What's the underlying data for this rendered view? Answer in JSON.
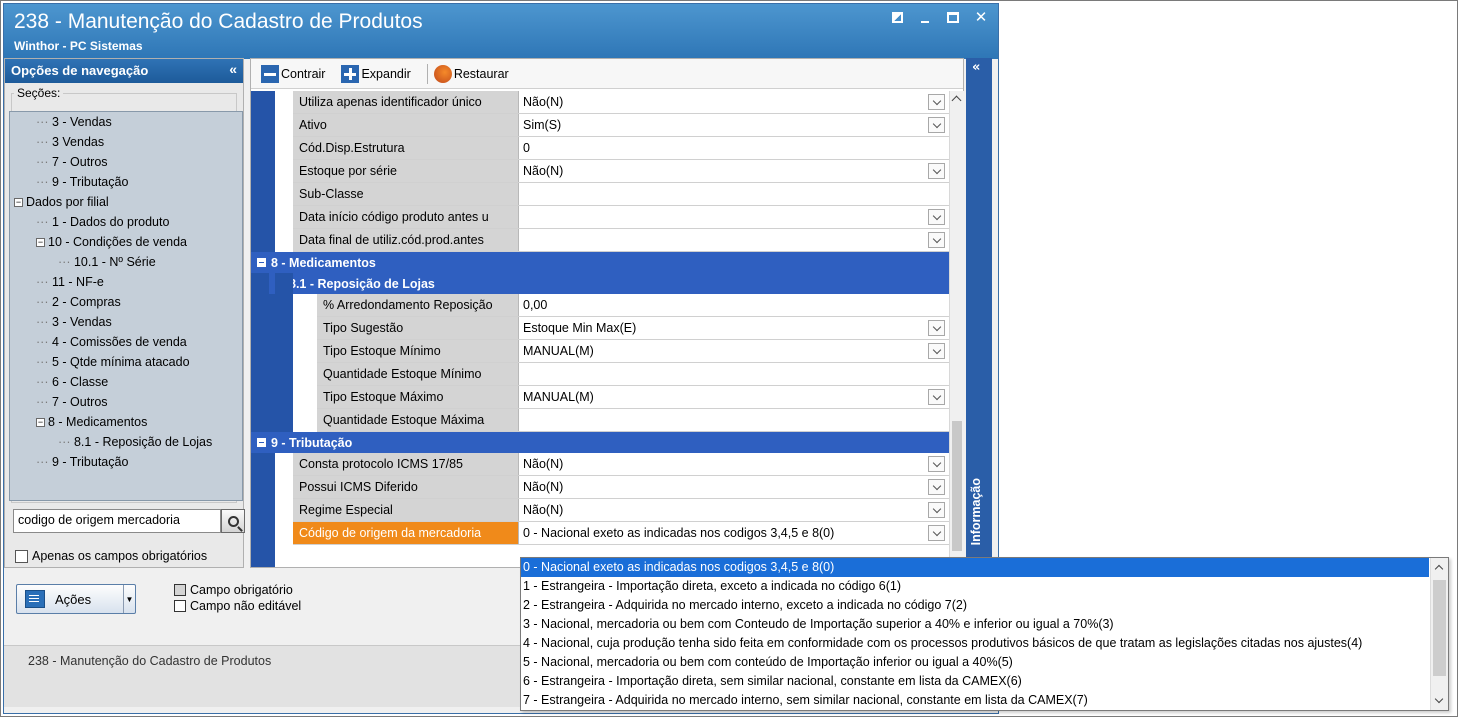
{
  "window": {
    "title": "238 - Manutenção do Cadastro de Produtos",
    "subtitle": "Winthor - PC Sistemas"
  },
  "nav": {
    "header": "Opções de navegação",
    "sections_label": "Seções:",
    "tree": [
      {
        "label": "3 - Vendas",
        "level": 1,
        "type": "leaf"
      },
      {
        "label": "3 Vendas",
        "level": 1,
        "type": "leaf"
      },
      {
        "label": "7 - Outros",
        "level": 1,
        "type": "leaf"
      },
      {
        "label": "9 - Tributação",
        "level": 1,
        "type": "leaf"
      },
      {
        "label": "Dados por filial",
        "level": 0,
        "type": "expanded"
      },
      {
        "label": "1 - Dados do produto",
        "level": 1,
        "type": "leaf"
      },
      {
        "label": "10 - Condições de venda",
        "level": 1,
        "type": "expanded"
      },
      {
        "label": "10.1 - Nº Série",
        "level": 2,
        "type": "leaf"
      },
      {
        "label": "11 - NF-e",
        "level": 1,
        "type": "leaf"
      },
      {
        "label": "2 - Compras",
        "level": 1,
        "type": "leaf"
      },
      {
        "label": "3 - Vendas",
        "level": 1,
        "type": "leaf"
      },
      {
        "label": "4 - Comissões de venda",
        "level": 1,
        "type": "leaf"
      },
      {
        "label": "5 - Qtde mínima atacado",
        "level": 1,
        "type": "leaf"
      },
      {
        "label": "6 - Classe",
        "level": 1,
        "type": "leaf"
      },
      {
        "label": "7 - Outros",
        "level": 1,
        "type": "leaf"
      },
      {
        "label": "8 - Medicamentos",
        "level": 1,
        "type": "expanded"
      },
      {
        "label": "8.1 -  Reposição de Lojas",
        "level": 2,
        "type": "leaf"
      },
      {
        "label": "9 - Tributação",
        "level": 1,
        "type": "leaf"
      }
    ],
    "search_value": "codigo de origem mercadoria",
    "required_only_label": "Apenas os campos obrigatórios"
  },
  "actions": {
    "button_label": "Ações",
    "legend_required": "Campo obrigatório",
    "legend_not_editable": "Campo não editável"
  },
  "status_bar": {
    "text": "238 - Manutenção do Cadastro de Produtos"
  },
  "toolbar": {
    "collapse_label": "Contrair",
    "expand_label": "Expandir",
    "restore_label": "Restaurar"
  },
  "grid": {
    "rows_top": [
      {
        "label": "Utiliza apenas identificador único",
        "value": "Não(N)",
        "dropdown": true
      },
      {
        "label": "Ativo",
        "value": "Sim(S)",
        "dropdown": true
      },
      {
        "label": "Cód.Disp.Estrutura",
        "value": "0",
        "dropdown": false
      },
      {
        "label": "Estoque por série",
        "value": "Não(N)",
        "dropdown": true
      },
      {
        "label": "Sub-Classe",
        "value": "",
        "dropdown": false
      },
      {
        "label": "Data início código produto antes u",
        "value": "",
        "dropdown": true
      },
      {
        "label": "Data final de utiliz.cód.prod.antes",
        "value": "",
        "dropdown": true
      }
    ],
    "section_8": "8 - Medicamentos",
    "section_81": "8.1 -  Reposição de Lojas",
    "rows_81": [
      {
        "label": "% Arredondamento Reposição",
        "value": "0,00",
        "dropdown": false
      },
      {
        "label": "Tipo Sugestão",
        "value": "Estoque Min Max(E)",
        "dropdown": true
      },
      {
        "label": "Tipo Estoque Mínimo",
        "value": "MANUAL(M)",
        "dropdown": true
      },
      {
        "label": "Quantidade Estoque Mínimo",
        "value": "",
        "dropdown": false
      },
      {
        "label": "Tipo Estoque Máximo",
        "value": "MANUAL(M)",
        "dropdown": true
      },
      {
        "label": "Quantidade Estoque Máxima",
        "value": "",
        "dropdown": false
      }
    ],
    "section_9": "9 - Tributação",
    "rows_9": [
      {
        "label": "Consta protocolo ICMS 17/85",
        "value": "Não(N)",
        "dropdown": true
      },
      {
        "label": "Possui ICMS Diferido",
        "value": "Não(N)",
        "dropdown": true
      },
      {
        "label": "Regime Especial",
        "value": "Não(N)",
        "dropdown": true
      },
      {
        "label": "Código de origem da mercadoria",
        "value": "0 - Nacional exeto as indicadas nos codigos 3,4,5 e 8(0)",
        "dropdown": true
      }
    ]
  },
  "info_panel": {
    "label": "Informação"
  },
  "origin_dropdown": {
    "options": [
      "0 - Nacional exeto as indicadas nos codigos 3,4,5 e 8(0)",
      "1 - Estrangeira - Importação direta, exceto a indicada no código 6(1)",
      "2 - Estrangeira - Adquirida no mercado interno, exceto a indicada no código 7(2)",
      "3 - Nacional, mercadoria ou bem com Conteudo de Importação superior a 40% e inferior ou igual a 70%(3)",
      "4 - Nacional, cuja produção tenha sido feita em conformidade com os processos produtivos básicos de que tratam as legislações citadas nos ajustes(4)",
      "5 - Nacional, mercadoria ou bem com conteúdo de Importação inferior ou igual a 40%(5)",
      "6 - Estrangeira - Importação direta, sem similar nacional, constante em lista da CAMEX(6)",
      "7 - Estrangeira - Adquirida no mercado interno, sem similar nacional, constante em lista da CAMEX(7)"
    ],
    "selected_index": 0
  },
  "colors": {
    "title_bar": "#2e76b6",
    "section_header": "#2f5fc0",
    "highlight": "#f08a1a",
    "selection": "#1a6ed8"
  }
}
